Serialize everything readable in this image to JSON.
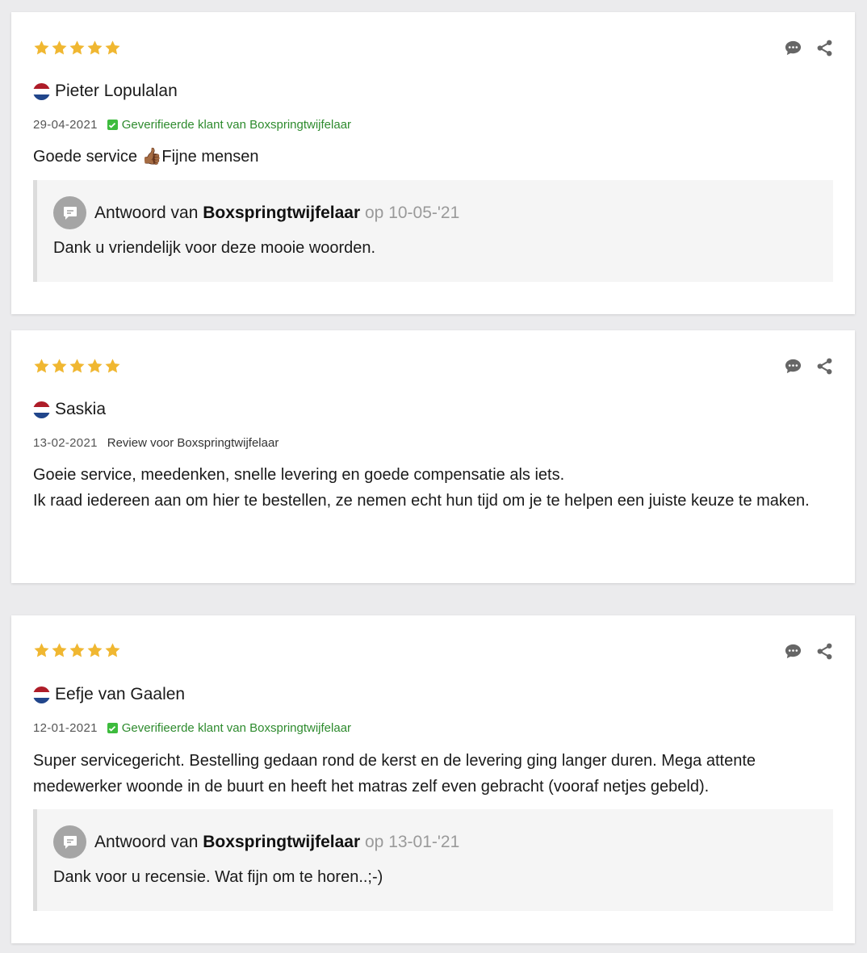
{
  "colors": {
    "star": "#f0b731",
    "verified": "#2e8b2e",
    "icon": "#666666"
  },
  "reviews": [
    {
      "rating": 5,
      "reviewer": "Pieter Lopulalan",
      "country_flag": "netherlands-flag",
      "date": "29-04-2021",
      "verification": "Geverifieerde klant van Boxspringtwijfelaar",
      "text": [
        "Goede service 👍🏾Fijne mensen"
      ],
      "reply": {
        "label": "Antwoord van",
        "shop": "Boxspringtwijfelaar",
        "date": "op 10-05-'21",
        "text": "Dank u vriendelijk voor deze mooie woorden."
      }
    },
    {
      "rating": 5,
      "reviewer": "Saskia",
      "country_flag": "netherlands-flag",
      "date": "13-02-2021",
      "review_for": "Review voor Boxspringtwijfelaar",
      "text": [
        "Goeie service, meedenken, snelle levering en goede compensatie als iets.",
        "Ik raad iedereen aan om hier te bestellen, ze nemen echt hun tijd om je te helpen een juiste keuze te maken."
      ]
    },
    {
      "rating": 5,
      "reviewer": "Eefje van Gaalen",
      "country_flag": "netherlands-flag",
      "date": "12-01-2021",
      "verification": "Geverifieerde klant van Boxspringtwijfelaar",
      "text": [
        "Super servicegericht. Bestelling gedaan rond de kerst en de levering ging langer duren. Mega attente medewerker woonde in de buurt en heeft het matras zelf even gebracht (vooraf netjes gebeld)."
      ],
      "reply": {
        "label": "Antwoord van",
        "shop": "Boxspringtwijfelaar",
        "date": "op 13-01-'21",
        "text": "Dank voor u recensie. Wat fijn om te horen..;-)"
      }
    }
  ]
}
